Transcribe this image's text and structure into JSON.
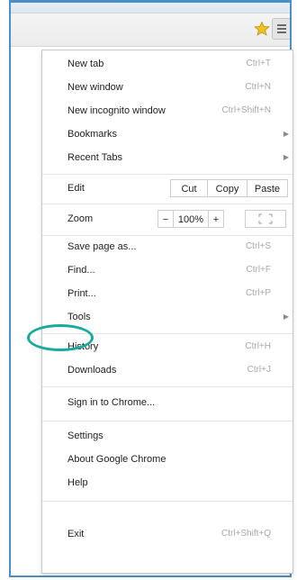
{
  "colors": {
    "frame_border": "#4a90c8",
    "highlight_ring": "#1aa99e",
    "star": "#f2c21a"
  },
  "toolbar": {
    "icons": [
      "star-icon",
      "hamburger-menu-icon"
    ]
  },
  "menu": {
    "group1": [
      {
        "label": "New tab",
        "shortcut": "Ctrl+T"
      },
      {
        "label": "New window",
        "shortcut": "Ctrl+N"
      },
      {
        "label": "New incognito window",
        "shortcut": "Ctrl+Shift+N"
      },
      {
        "label": "Bookmarks",
        "submenu": true
      },
      {
        "label": "Recent Tabs",
        "submenu": true
      }
    ],
    "edit": {
      "label": "Edit",
      "cut": "Cut",
      "copy": "Copy",
      "paste": "Paste"
    },
    "zoom": {
      "label": "Zoom",
      "minus": "−",
      "value": "100%",
      "plus": "+"
    },
    "group2": [
      {
        "label": "Save page as...",
        "shortcut": "Ctrl+S"
      },
      {
        "label": "Find...",
        "shortcut": "Ctrl+F"
      },
      {
        "label": "Print...",
        "shortcut": "Ctrl+P"
      },
      {
        "label": "Tools",
        "submenu": true
      }
    ],
    "group3": [
      {
        "label": "History",
        "shortcut": "Ctrl+H"
      },
      {
        "label": "Downloads",
        "shortcut": "Ctrl+J"
      }
    ],
    "group4": [
      {
        "label": "Sign in to Chrome..."
      }
    ],
    "group5": [
      {
        "label": "Settings"
      },
      {
        "label": "About Google Chrome"
      },
      {
        "label": "Help"
      }
    ],
    "group6": [
      {
        "label": "Exit",
        "shortcut": "Ctrl+Shift+Q"
      }
    ]
  }
}
